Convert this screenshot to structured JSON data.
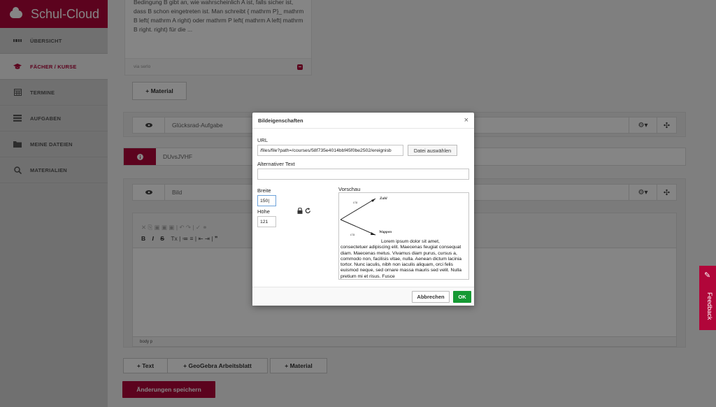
{
  "brand": {
    "name": "Schul-Cloud"
  },
  "sidebar": {
    "items": [
      {
        "label": "ÜBERSICHT",
        "icon": "dashboard-icon",
        "active": false
      },
      {
        "label": "FÄCHER / KURSE",
        "icon": "graduation-cap-icon",
        "active": true
      },
      {
        "label": "TERMINE",
        "icon": "calendar-icon",
        "active": false
      },
      {
        "label": "AUFGABEN",
        "icon": "tasks-icon",
        "active": false
      },
      {
        "label": "MEINE DATEIEN",
        "icon": "folder-icon",
        "active": false
      },
      {
        "label": "MATERIALIEN",
        "icon": "search-icon",
        "active": false
      }
    ]
  },
  "quiz_card": {
    "text": "Bedingung B gibt an, wie wahrscheinlich A ist, falls sicher ist, dass B schon eingetreten ist. Man schreibt { mathrm P}_ mathrm B left( mathrm A right) oder mathrm P left( mathrm A left| mathrm B right. right) für die ...",
    "source": "via serlo"
  },
  "buttons": {
    "add_material_top": "+ Material",
    "add_text": "+ Text",
    "add_geogebra": "+ GeoGebra Arbeitsblatt",
    "add_material_bottom": "+ Material",
    "save_changes": "Änderungen speichern"
  },
  "sections": {
    "gluecksrad": {
      "title": "Glücksrad-Aufgabe"
    },
    "duv": {
      "title": "DUvsJVHF",
      "info_icon": "i"
    },
    "bild": {
      "title": "Bild"
    }
  },
  "editor": {
    "toolbar_row1": "✕ ⎘ ▣ ▣ ▣ | ↶ ↷ | ✓ ⚭",
    "toolbar_row2_bold": "B",
    "toolbar_row2_italic": "I",
    "toolbar_row2_strike": "S",
    "toolbar_row2_rest": "Tx | ≔ ≡ | ⇤ ⇥ | ❞",
    "status_path": "body  p"
  },
  "dialog": {
    "title": "Bildeigenschaften",
    "close": "×",
    "url_label": "URL",
    "url_value": "/files/file?path=/courses/58f735e4014bbf45f0be2502/ereignisb",
    "choose_file": "Datei auswählen",
    "alt_label": "Alternativer Text",
    "alt_value": "",
    "width_label": "Breite",
    "width_value": "150|",
    "height_label": "Höhe",
    "height_value": "121",
    "preview_label": "Vorschau",
    "preview_diagram": {
      "upper_label": "Zahl",
      "upper_fraction": "c/a",
      "lower_label": "Wappen",
      "lower_fraction": "c/a"
    },
    "preview_text": "Lorem ipsum dolor sit amet, consectetuer adipiscing elit. Maecenas feugiat consequat diam. Maecenas metus. Vivamus diam purus, cursus a, commodo non, facilisis vitae, nulla. Aenean dictum lacinia tortor. Nunc iaculis, nibh non iaculis aliquam, orci felis euismod neque, sed ornare massa mauris sed velit. Nulla pretium mi et risus. Fusce",
    "cancel": "Abbrechen",
    "ok": "OK"
  },
  "feedback": {
    "label": "Feedback"
  },
  "colors": {
    "brand": "#b1063a",
    "ok": "#159933"
  }
}
